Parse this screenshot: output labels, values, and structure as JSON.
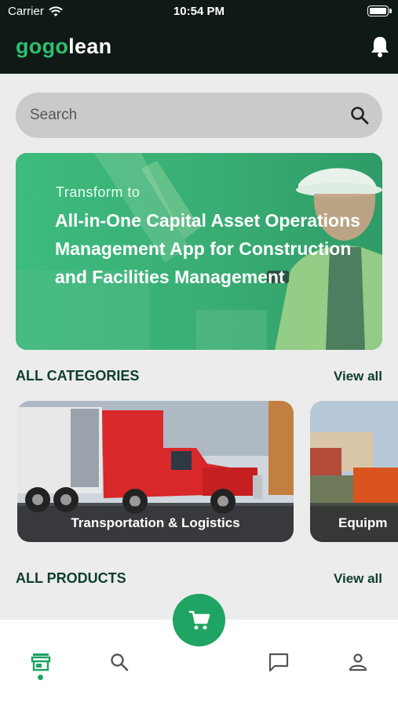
{
  "status_bar": {
    "carrier": "Carrier",
    "time": "10:54 PM"
  },
  "header": {
    "logo_part1": "gogo",
    "logo_part2": "lean",
    "icons": [
      "bell-icon"
    ]
  },
  "search": {
    "placeholder": "Search",
    "icon": "search-icon"
  },
  "banner": {
    "line1": "Transform to",
    "line2": "All-in-One Capital Asset Operations Management App for Construction and Facilities Management"
  },
  "categories": {
    "title": "ALL CATEGORIES",
    "view_all": "View all",
    "items": [
      {
        "label": "Transportation & Logistics"
      },
      {
        "label": "Equipm"
      }
    ]
  },
  "products": {
    "title": "ALL PRODUCTS",
    "view_all": "View all"
  },
  "bottom_nav": {
    "items": [
      "store-icon",
      "search-icon",
      "chat-icon",
      "profile-icon"
    ],
    "center": "cart-icon",
    "active_color": "#1fa463"
  }
}
